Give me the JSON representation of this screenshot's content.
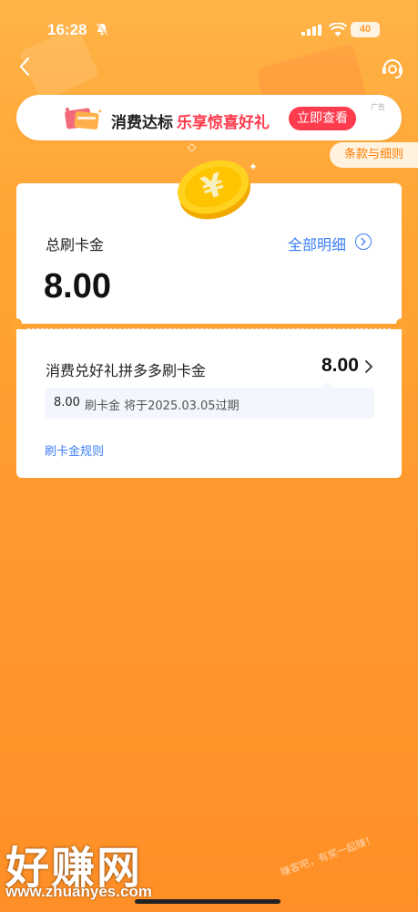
{
  "status_bar": {
    "time": "16:28",
    "battery": "40"
  },
  "ad": {
    "text_primary": "消费达标",
    "text_highlight": "乐享惊喜好礼",
    "button_label": "立即查看",
    "tag": "广告"
  },
  "terms_label": "条款与细则",
  "card": {
    "total_label": "总刷卡金",
    "detail_link": "全部明细",
    "total_amount": "8.00",
    "item": {
      "title": "消费兑好礼拼多多刷卡金",
      "amount": "8.00",
      "expire_amount": "8.00",
      "expire_text": "刷卡金  将于2025.03.05过期"
    },
    "rules_link": "刷卡金规则"
  },
  "watermark": {
    "logo": "好赚网",
    "url": "www.zhuanyes.com",
    "side_text": "赚客吧，有奖一起赚！"
  },
  "colors": {
    "background": "#ffa533",
    "accent_red": "#ff3b4e",
    "link_blue": "#3d7ef6",
    "terms_orange": "#ff7a00"
  }
}
